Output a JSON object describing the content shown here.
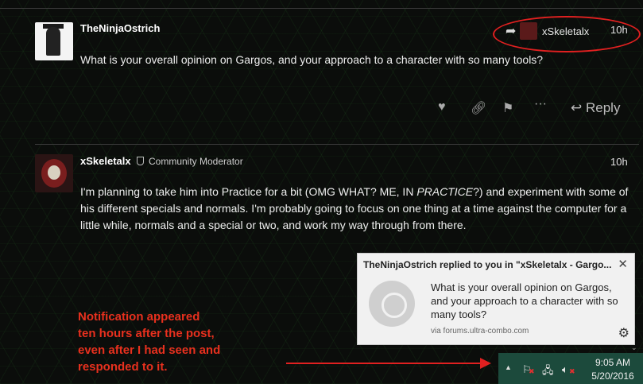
{
  "post1": {
    "username": "TheNinjaOstrich",
    "reply_to_user": "xSkeletalx",
    "time": "10h",
    "text": "What is your overall opinion on Gargos, and your approach to a character with so many tools?",
    "actions": {
      "reply_label": "Reply"
    }
  },
  "post2": {
    "username": "xSkeletalx",
    "user_title": "Community Moderator",
    "time": "10h",
    "text_a": "I'm planning to take him into Practice for a bit (OMG WHAT? ME, IN ",
    "text_em": "PRACTICE",
    "text_b": "?) and experiment with some of his different specials and normals. I'm probably going to focus on one thing at a time against the computer for a little while, normals and a special or two, and work my way through from there."
  },
  "toast": {
    "title": "TheNinjaOstrich replied to you in \"xSkeletalx - Gargo...",
    "body": "What is your overall opinion on Gargos, and your approach to a character with so many tools?",
    "via": "via forums.ultra-combo.com"
  },
  "annotation": {
    "lines": [
      "Notification appeared",
      "ten hours after the post,",
      "even after I had seen and",
      "responded to it."
    ]
  },
  "taskbar": {
    "time": "9:05 AM",
    "date": "5/20/2016"
  },
  "icons": {
    "like": "heart-icon",
    "link": "link-icon",
    "flag": "flag-icon",
    "more": "more-icon",
    "reply": "reply-icon",
    "close": "close-icon",
    "settings": "gear-icon"
  },
  "colors": {
    "annotation_red": "#e8301e",
    "highlight_circle": "#e02020",
    "taskbar": "#1c4a3c"
  }
}
